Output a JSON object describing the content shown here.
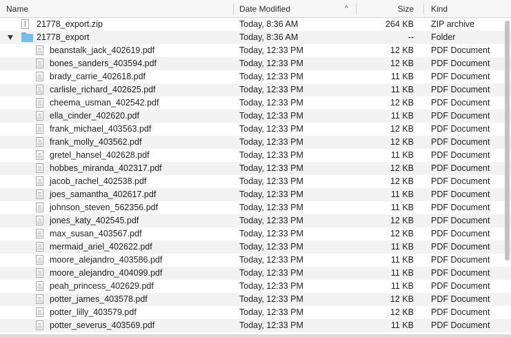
{
  "columns": {
    "name": "Name",
    "date_modified": "Date Modified",
    "size": "Size",
    "kind": "Kind",
    "sort_indicator": "^"
  },
  "files": [
    {
      "name": "21778_export.zip",
      "date": "Today, 8:36 AM",
      "size": "264 KB",
      "kind": "ZIP archive",
      "icon": "zip-icon",
      "level": 0
    },
    {
      "name": "21778_export",
      "date": "Today, 8:36 AM",
      "size": "--",
      "kind": "Folder",
      "icon": "folder-icon",
      "level": 0,
      "expanded": true
    },
    {
      "name": "beanstalk_jack_402619.pdf",
      "date": "Today, 12:33 PM",
      "size": "12 KB",
      "kind": "PDF Document",
      "icon": "pdf-icon",
      "level": 1
    },
    {
      "name": "bones_sanders_403594.pdf",
      "date": "Today, 12:33 PM",
      "size": "12 KB",
      "kind": "PDF Document",
      "icon": "pdf-icon",
      "level": 1
    },
    {
      "name": "brady_carrie_402618.pdf",
      "date": "Today, 12:33 PM",
      "size": "11 KB",
      "kind": "PDF Document",
      "icon": "pdf-icon",
      "level": 1
    },
    {
      "name": "carlisle_richard_402625.pdf",
      "date": "Today, 12:33 PM",
      "size": "11 KB",
      "kind": "PDF Document",
      "icon": "pdf-icon",
      "level": 1
    },
    {
      "name": "cheema_usman_402542.pdf",
      "date": "Today, 12:33 PM",
      "size": "12 KB",
      "kind": "PDF Document",
      "icon": "pdf-icon",
      "level": 1
    },
    {
      "name": "ella_cinder_402620.pdf",
      "date": "Today, 12:33 PM",
      "size": "11 KB",
      "kind": "PDF Document",
      "icon": "pdf-icon",
      "level": 1
    },
    {
      "name": "frank_michael_403563.pdf",
      "date": "Today, 12:33 PM",
      "size": "12 KB",
      "kind": "PDF Document",
      "icon": "pdf-icon",
      "level": 1
    },
    {
      "name": "frank_molly_403562.pdf",
      "date": "Today, 12:33 PM",
      "size": "12 KB",
      "kind": "PDF Document",
      "icon": "pdf-icon",
      "level": 1
    },
    {
      "name": "gretel_hansel_402628.pdf",
      "date": "Today, 12:33 PM",
      "size": "11 KB",
      "kind": "PDF Document",
      "icon": "pdf-icon",
      "level": 1
    },
    {
      "name": "hobbes_miranda_402317.pdf",
      "date": "Today, 12:33 PM",
      "size": "12 KB",
      "kind": "PDF Document",
      "icon": "pdf-icon",
      "level": 1
    },
    {
      "name": "jacob_rachel_402538.pdf",
      "date": "Today, 12:33 PM",
      "size": "12 KB",
      "kind": "PDF Document",
      "icon": "pdf-icon",
      "level": 1
    },
    {
      "name": "joes_samantha_402617.pdf",
      "date": "Today, 12:33 PM",
      "size": "11 KB",
      "kind": "PDF Document",
      "icon": "pdf-icon",
      "level": 1
    },
    {
      "name": "johnson_steven_562356.pdf",
      "date": "Today, 12:33 PM",
      "size": "11 KB",
      "kind": "PDF Document",
      "icon": "pdf-icon",
      "level": 1
    },
    {
      "name": "jones_katy_402545.pdf",
      "date": "Today, 12:33 PM",
      "size": "12 KB",
      "kind": "PDF Document",
      "icon": "pdf-icon",
      "level": 1
    },
    {
      "name": "max_susan_403567.pdf",
      "date": "Today, 12:33 PM",
      "size": "12 KB",
      "kind": "PDF Document",
      "icon": "pdf-icon",
      "level": 1
    },
    {
      "name": "mermaid_ariel_402622.pdf",
      "date": "Today, 12:33 PM",
      "size": "11 KB",
      "kind": "PDF Document",
      "icon": "pdf-icon",
      "level": 1
    },
    {
      "name": "moore_alejandro_403586.pdf",
      "date": "Today, 12:33 PM",
      "size": "11 KB",
      "kind": "PDF Document",
      "icon": "pdf-icon",
      "level": 1
    },
    {
      "name": "moore_alejandro_404099.pdf",
      "date": "Today, 12:33 PM",
      "size": "11 KB",
      "kind": "PDF Document",
      "icon": "pdf-icon",
      "level": 1
    },
    {
      "name": "peah_princess_402629.pdf",
      "date": "Today, 12:33 PM",
      "size": "11 KB",
      "kind": "PDF Document",
      "icon": "pdf-icon",
      "level": 1
    },
    {
      "name": "potter_james_403578.pdf",
      "date": "Today, 12:33 PM",
      "size": "12 KB",
      "kind": "PDF Document",
      "icon": "pdf-icon",
      "level": 1
    },
    {
      "name": "potter_lilly_403579.pdf",
      "date": "Today, 12:33 PM",
      "size": "12 KB",
      "kind": "PDF Document",
      "icon": "pdf-icon",
      "level": 1
    },
    {
      "name": "potter_severus_403569.pdf",
      "date": "Today, 12:33 PM",
      "size": "11 KB",
      "kind": "PDF Document",
      "icon": "pdf-icon",
      "level": 1
    }
  ],
  "colors": {
    "folder": "#6fc0ee",
    "alt_row": "#f2f2f2",
    "header_bg": "#f6f6f6"
  }
}
